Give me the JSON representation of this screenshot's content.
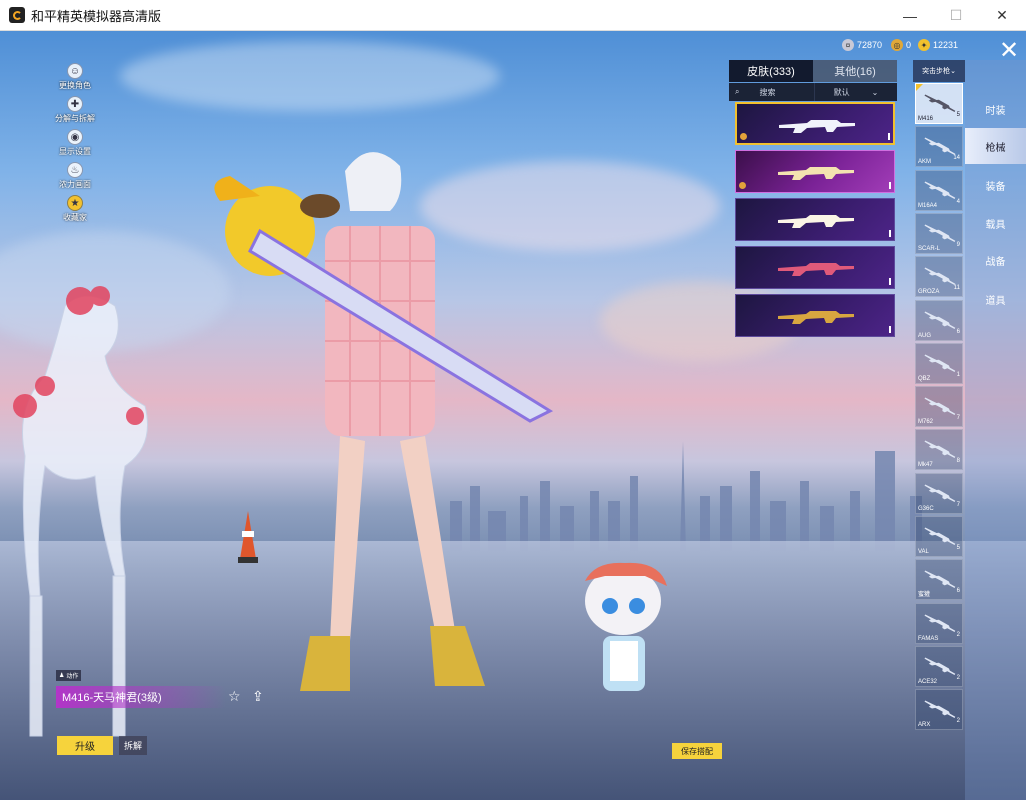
{
  "window": {
    "title": "和平精英模拟器高清版",
    "minimize": "—",
    "maximize": "☐",
    "close": "✕"
  },
  "currencies": [
    {
      "icon": "coin-icon",
      "value": "72870"
    },
    {
      "icon": "token-icon",
      "value": "0"
    },
    {
      "icon": "ticket-icon",
      "value": "12231"
    }
  ],
  "left_menu": [
    {
      "label": "更换角色",
      "icon": "person-icon"
    },
    {
      "label": "分解与拆解",
      "icon": "puzzle-icon"
    },
    {
      "label": "显示设置",
      "icon": "eye-icon"
    },
    {
      "label": "浓力画面",
      "icon": "flame-icon"
    },
    {
      "label": "收藏家",
      "icon": "medal-icon"
    }
  ],
  "right_nav": [
    {
      "label": "时装",
      "active": false
    },
    {
      "label": "枪械",
      "active": true
    },
    {
      "label": "装备",
      "active": false
    },
    {
      "label": "载具",
      "active": false
    },
    {
      "label": "战备",
      "active": false
    },
    {
      "label": "道具",
      "active": false
    }
  ],
  "skin_panel": {
    "tab_skins": "皮肤(333)",
    "tab_other": "其他(16)",
    "search_label": "搜索",
    "sort_label": "默认",
    "cards": [
      {
        "selected": true,
        "style": "purple",
        "gun_color": "#f1f3fb"
      },
      {
        "selected": false,
        "style": "pink",
        "gun_color": "#f3e3b0"
      },
      {
        "selected": false,
        "style": "purple",
        "gun_color": "#fbf5e6"
      },
      {
        "selected": false,
        "style": "purple",
        "gun_color": "#e05a7a"
      },
      {
        "selected": false,
        "style": "purple",
        "gun_color": "#d8a640"
      }
    ]
  },
  "weapon_list": {
    "header": "突击步枪",
    "items": [
      {
        "name": "M416",
        "count": "5",
        "active": true
      },
      {
        "name": "AKM",
        "count": "14",
        "active": false
      },
      {
        "name": "M16A4",
        "count": "4",
        "active": false
      },
      {
        "name": "SCAR-L",
        "count": "9",
        "active": false
      },
      {
        "name": "GROZA",
        "count": "11",
        "active": false
      },
      {
        "name": "AUG",
        "count": "6",
        "active": false
      },
      {
        "name": "QBZ",
        "count": "1",
        "active": false
      },
      {
        "name": "M762",
        "count": "7",
        "active": false
      },
      {
        "name": "Mk47",
        "count": "8",
        "active": false
      },
      {
        "name": "G36C",
        "count": "7",
        "active": false
      },
      {
        "name": "VAL",
        "count": "5",
        "active": false
      },
      {
        "name": "蜜獾",
        "count": "6",
        "active": false
      },
      {
        "name": "FAMAS",
        "count": "2",
        "active": false
      },
      {
        "name": "ACE32",
        "count": "2",
        "active": false
      },
      {
        "name": "ARX",
        "count": "2",
        "active": false
      }
    ]
  },
  "item_info": {
    "tag": "动作",
    "name": "M416-天马神君(3级)"
  },
  "buttons": {
    "upgrade": "升级",
    "dismantle": "拆解",
    "save_outfit": "保存搭配"
  }
}
